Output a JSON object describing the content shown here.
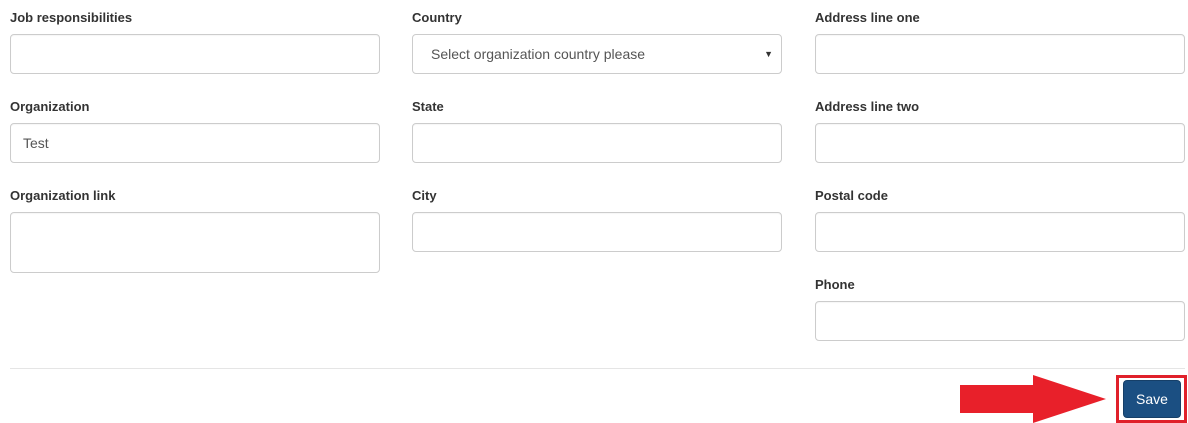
{
  "form": {
    "left_column": {
      "job_responsibilities": {
        "label": "Job responsibilities",
        "value": ""
      },
      "organization": {
        "label": "Organization",
        "value": "Test"
      },
      "organization_link": {
        "label": "Organization link",
        "value": ""
      }
    },
    "middle_column": {
      "country": {
        "label": "Country",
        "selected": "Select organization country please",
        "caret": "▼"
      },
      "state": {
        "label": "State",
        "value": ""
      },
      "city": {
        "label": "City",
        "value": ""
      }
    },
    "right_column": {
      "address_line_one": {
        "label": "Address line one",
        "value": ""
      },
      "address_line_two": {
        "label": "Address line two",
        "value": ""
      },
      "postal_code": {
        "label": "Postal code",
        "value": ""
      },
      "phone": {
        "label": "Phone",
        "value": ""
      }
    }
  },
  "footer": {
    "save_label": "Save"
  },
  "colors": {
    "save_button": "#1b4f82",
    "highlight": "#e0202a",
    "arrow": "#e8202a"
  },
  "annotations": {
    "arrow_icon": "arrow-right-icon"
  }
}
